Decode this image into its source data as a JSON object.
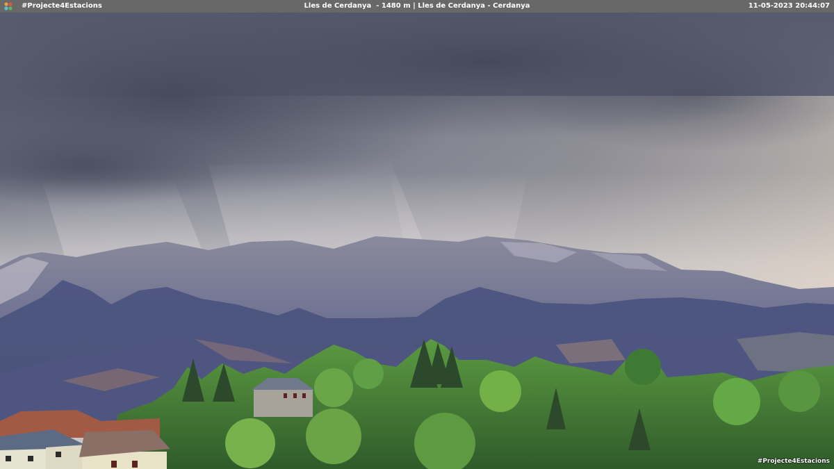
{
  "header": {
    "brand": "#Projecte4Estacions",
    "location": "Lles de Cerdanya  - 1480 m | Lles de Cerdanya - Cerdanya",
    "timestamp": "11-05-2023 20:44:07"
  },
  "watermark": "#Projecte4Estacions",
  "colors": {
    "bar_bg": "#686868",
    "sky_dark": "#4e5468",
    "sky_light": "#d9d6d4",
    "mountain": "#5a6189",
    "forest": "#4d8a38"
  },
  "icons": {
    "logo": "station-logo-icon"
  }
}
